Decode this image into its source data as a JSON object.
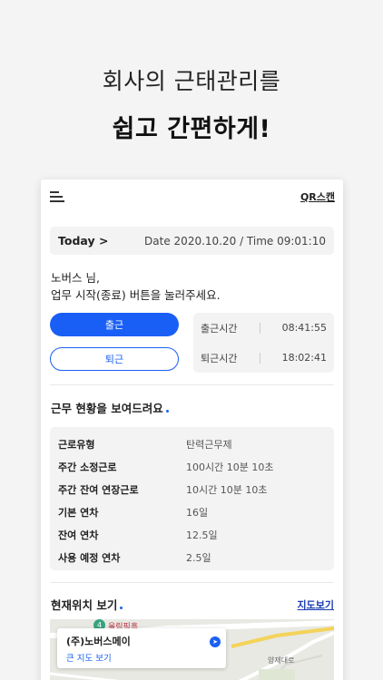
{
  "hero": {
    "line1": "회사의 근태관리를",
    "line2": "쉽고 간편하게!"
  },
  "header": {
    "menu_icon": "hamburger-menu-icon",
    "qr_label": "QR스캔"
  },
  "today_bar": {
    "today_label": "Today >",
    "datetime": "Date 2020.10.20  /  Time 09:01:10"
  },
  "greeting": {
    "line1": "노버스 님,",
    "line2": "업무 시작(종료) 버튼을 눌러주세요."
  },
  "attendance": {
    "in_button": "출근",
    "out_button": "퇴근",
    "in_time_label": "출근시간",
    "in_time_value": "08:41:55",
    "out_time_label": "퇴근시간",
    "out_time_value": "18:02:41"
  },
  "work_status": {
    "title": "근무 현황을 보여드려요",
    "rows": [
      {
        "label": "근로유형",
        "value": "탄력근무제"
      },
      {
        "label": "주간 소정근로",
        "value": "100시간 10분 10초"
      },
      {
        "label": "주간 잔여 연장근로",
        "value": "10시간 10분 10초"
      },
      {
        "label": "기본 연차",
        "value": "16일"
      },
      {
        "label": "잔여 연차",
        "value": "12.5일"
      },
      {
        "label": "사용 예정 연차",
        "value": "2.5일"
      }
    ]
  },
  "location": {
    "title": "현재위치 보기",
    "map_link": "지도보기",
    "map_card_name": "(주)노버스메이",
    "map_card_link": "큰 지도 보기",
    "map_place_label": "올림픽홀",
    "map_side_label": "양재대로"
  },
  "colors": {
    "accent": "#1a5ff5",
    "background": "#f4f4f4"
  }
}
